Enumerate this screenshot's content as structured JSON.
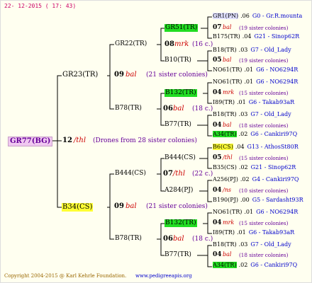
{
  "header": {
    "date": "22- 12-2015 ( 17: 43)"
  },
  "footer": {
    "copyright": "Copyright 2004-2015 @ Karl Kehrle Foundation.",
    "url": "www.pedigreeapis.org"
  },
  "root": {
    "name": "GR77(BG)"
  },
  "gen1": [
    {
      "name": "GR23(TR)",
      "year": "09",
      "mark": "bal",
      "info": "(21 sister colonies)"
    },
    {
      "name": "B34(CS)",
      "year": "09",
      "mark": "bal",
      "info": "(21 sister colonies)"
    }
  ],
  "root_mid": {
    "year": "12",
    "mark": "/thl",
    "info": "(Drones from 28 sister colonies)"
  },
  "gen2": [
    {
      "name": "GR22(TR)",
      "year": "08",
      "mark": "mrk",
      "info": "(16 c.)"
    },
    {
      "name": "B78(TR)",
      "year": "06",
      "mark": "bal",
      "info": "(18 c.)"
    },
    {
      "name": "B444(CS)",
      "year": "07",
      "mark": "/thl",
      "info": "(22 c.)"
    },
    {
      "name": "B78(TR)",
      "year": "06",
      "mark": "bal",
      "info": "(18 c.)"
    }
  ],
  "gen3": [
    {
      "name": "GR51(TR)",
      "year": "07",
      "mark": "bal",
      "info": "(19 sister colonies)"
    },
    {
      "name": "B10(TR)",
      "year": "05",
      "mark": "bal",
      "info": "(19 sister colonies)"
    },
    {
      "name": "B132(TR)",
      "year": "04",
      "mark": "mrk",
      "info": "(15 sister colonies)"
    },
    {
      "name": "B77(TR)",
      "year": "04",
      "mark": "bal",
      "info": "(18 sister colonies)"
    },
    {
      "name": "B6(CS)",
      "year": "05",
      "mark": "/thl",
      "info": "(15 sister colonies)"
    },
    {
      "name": "A284(PJ)",
      "year": "04",
      "mark": "/ns",
      "info": "(10 sister colonies)"
    },
    {
      "name": "B132(TR)",
      "year": "04",
      "mark": "mrk",
      "info": "(15 sister colonies)"
    },
    {
      "name": "B77(TR)",
      "year": "04",
      "mark": "bal",
      "info": "(18 sister colonies)"
    }
  ],
  "gen3_drone": [
    {
      "name": "GR1(PN)",
      "year": ".06",
      "src": "G0 - Gr.R.mounta"
    },
    {
      "name": "B175(TR)",
      "year": ".04",
      "src": "G21 - Sinop62R"
    },
    {
      "name": "B18(TR)",
      "year": ".03",
      "src": "G7 - Old_Lady"
    },
    {
      "name": "NO61(TR)",
      "year": ".01",
      "src": "G6 - NO6294R"
    },
    {
      "name": "NO61(TR)",
      "year": ".01",
      "src": "G6 - NO6294R"
    },
    {
      "name": "I89(TR)",
      "year": ".01",
      "src": "G6 - Takab93aR"
    },
    {
      "name": "B18(TR)",
      "year": ".03",
      "src": "G7 - Old_Lady"
    },
    {
      "name": "A34(TR)",
      "year": ".02",
      "src": "G6 - Cankiri97Q"
    },
    {
      "name": "B6(CS)",
      "year": ".04",
      "src": "G13 - AthosSt80R"
    },
    {
      "name": "B35(CS)",
      "year": ".02",
      "src": "G21 - Sinop62R"
    },
    {
      "name": "A256(PJ)",
      "year": ".02",
      "src": "G4 - Cankiri97Q"
    },
    {
      "name": "B190(PJ)",
      "year": ".00",
      "src": "G5 - Sardasht93R"
    },
    {
      "name": "NO61(TR)",
      "year": ".01",
      "src": "G6 - NO6294R"
    },
    {
      "name": "I89(TR)",
      "year": ".01",
      "src": "G6 - Takab93aR"
    },
    {
      "name": "B18(TR)",
      "year": ".03",
      "src": "G7 - Old_Lady"
    },
    {
      "name": "A34(TR)",
      "year": ".02",
      "src": "G6 - Cankiri97Q"
    }
  ]
}
